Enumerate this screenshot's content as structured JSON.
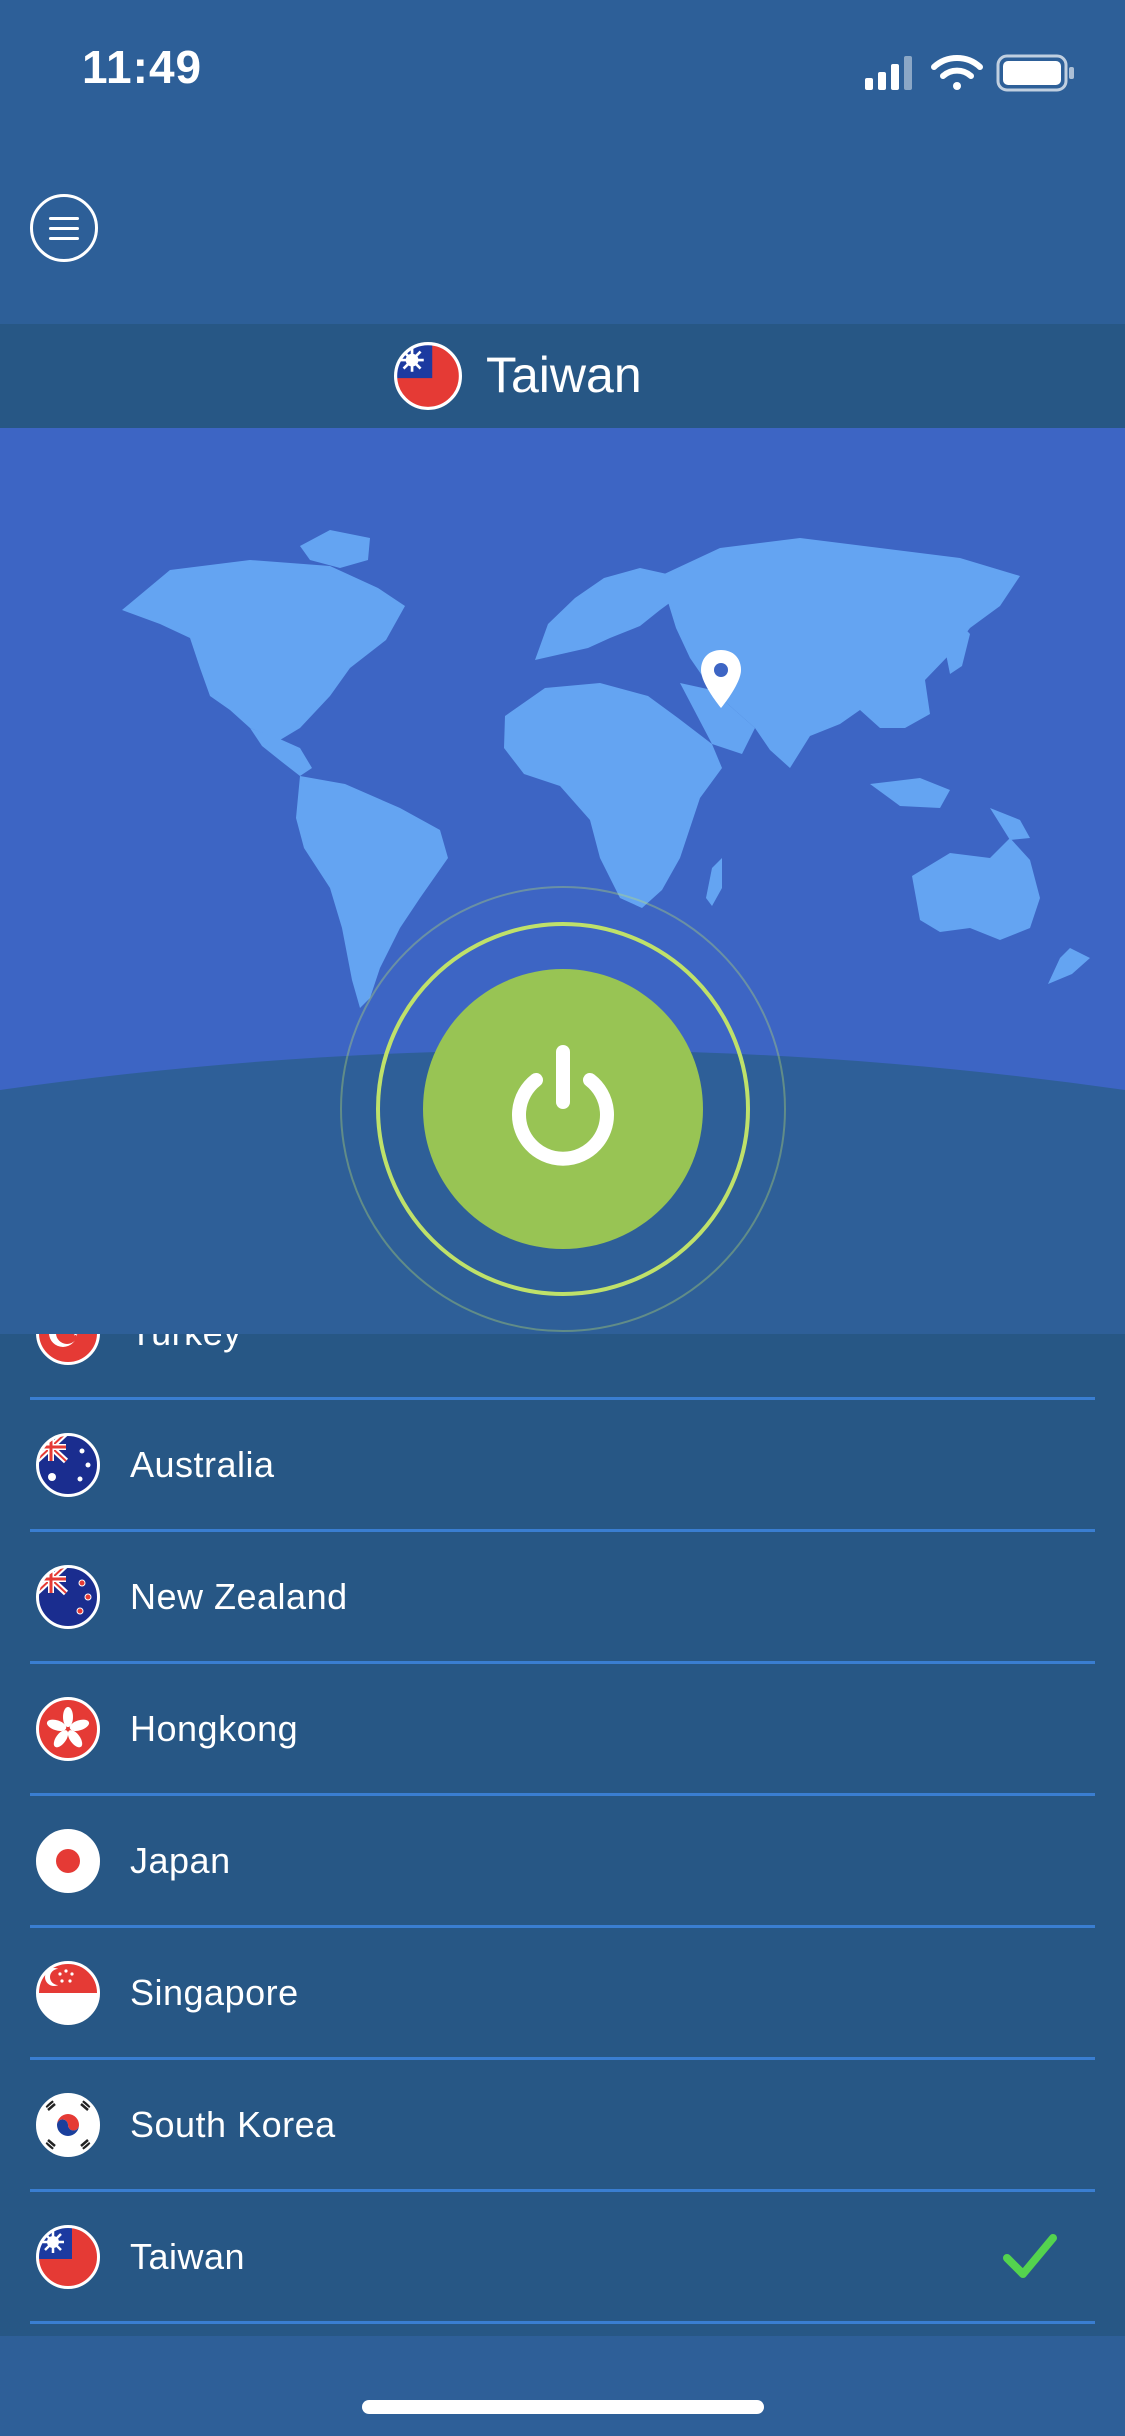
{
  "status_bar": {
    "time": "11:49"
  },
  "header": {
    "menu_icon": "hamburger-menu-icon"
  },
  "selected_server": {
    "name": "Taiwan",
    "flag_icon": "taiwan-flag-icon"
  },
  "map": {
    "pin_icon": "location-pin-icon"
  },
  "connect": {
    "power_icon": "power-icon",
    "button_color": "#98c454",
    "ring_color": "#bfe16a"
  },
  "countries": [
    {
      "name": "Turkey",
      "flag_icon": "turkey-flag-icon",
      "selected": false
    },
    {
      "name": "Australia",
      "flag_icon": "australia-flag-icon",
      "selected": false
    },
    {
      "name": "New Zealand",
      "flag_icon": "new-zealand-flag-icon",
      "selected": false
    },
    {
      "name": "Hongkong",
      "flag_icon": "hongkong-flag-icon",
      "selected": false
    },
    {
      "name": "Japan",
      "flag_icon": "japan-flag-icon",
      "selected": false
    },
    {
      "name": "Singapore",
      "flag_icon": "singapore-flag-icon",
      "selected": false
    },
    {
      "name": "South Korea",
      "flag_icon": "south-korea-flag-icon",
      "selected": false
    },
    {
      "name": "Taiwan",
      "flag_icon": "taiwan-flag-icon",
      "selected": true
    }
  ],
  "colors": {
    "background": "#2d5f98",
    "list_background": "#275785",
    "map_sky": "#3d65c4",
    "land": "#64a4f2",
    "divider": "#3a7ed1",
    "check": "#54d34e"
  }
}
